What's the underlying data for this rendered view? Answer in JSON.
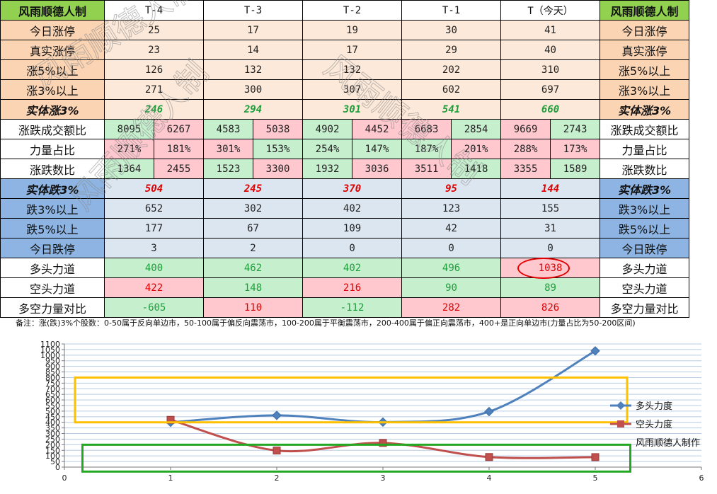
{
  "table": {
    "brand": "风雨顺德人制",
    "columns": [
      "T-4",
      "T-3",
      "T-2",
      "T-1",
      "T（今天）"
    ],
    "rows": [
      {
        "label": "今日涨停",
        "values": [
          "25",
          "17",
          "19",
          "30",
          "41"
        ]
      },
      {
        "label": "真实涨停",
        "values": [
          "23",
          "14",
          "17",
          "29",
          "40"
        ]
      },
      {
        "label": "涨5%以上",
        "values": [
          "126",
          "132",
          "132",
          "202",
          "310"
        ]
      },
      {
        "label": "涨3%以上",
        "values": [
          "271",
          "300",
          "307",
          "602",
          "697"
        ]
      },
      {
        "label": "实体涨3%",
        "values": [
          "246",
          "294",
          "301",
          "541",
          "660"
        ]
      },
      {
        "label": "涨跌成交额比",
        "pairs": [
          [
            "8095",
            "6267"
          ],
          [
            "4583",
            "5038"
          ],
          [
            "4902",
            "4452"
          ],
          [
            "6683",
            "2854"
          ],
          [
            "9669",
            "2743"
          ]
        ]
      },
      {
        "label": "力量占比",
        "pairs": [
          [
            "271%",
            "181%"
          ],
          [
            "301%",
            "153%"
          ],
          [
            "254%",
            "147%"
          ],
          [
            "187%",
            "201%"
          ],
          [
            "288%",
            "173%"
          ]
        ]
      },
      {
        "label": "涨跌数比",
        "pairs": [
          [
            "1364",
            "2455"
          ],
          [
            "1523",
            "3300"
          ],
          [
            "1932",
            "3036"
          ],
          [
            "3511",
            "1418"
          ],
          [
            "3355",
            "1589"
          ]
        ]
      },
      {
        "label": "实体跌3%",
        "values": [
          "504",
          "245",
          "370",
          "95",
          "144"
        ]
      },
      {
        "label": "跌3%以上",
        "values": [
          "652",
          "302",
          "402",
          "123",
          "155"
        ]
      },
      {
        "label": "跌5%以上",
        "values": [
          "177",
          "67",
          "109",
          "42",
          "31"
        ]
      },
      {
        "label": "今日跌停",
        "values": [
          "3",
          "2",
          "0",
          "0",
          "0"
        ]
      },
      {
        "label": "多头力道",
        "values": [
          "400",
          "462",
          "402",
          "496",
          "1038"
        ]
      },
      {
        "label": "空头力道",
        "values": [
          "422",
          "148",
          "216",
          "90",
          "89"
        ]
      },
      {
        "label": "多空力量对比",
        "values": [
          "-605",
          "110",
          "-112",
          "282",
          "826"
        ]
      }
    ],
    "note": "备注：涨(跌)3%个股数：0-50属于反向单边市，50-100属于偏反向震荡市，100-200属于平衡震荡市，200-400属于偏正向震荡市，400+是正向单边市(力量占比为50-200区间)"
  },
  "watermark": "风雨顺德人制",
  "colors": {
    "green_fill": "#c6efce",
    "pink_fill": "#ffc7ce",
    "brand_green": "#92d050",
    "series_bull": "#4f81bd",
    "series_bear": "#c0504d",
    "box_yellow": "#ffc000",
    "box_green": "#22a822",
    "highlight_circle": "#e00000"
  },
  "chart_data": {
    "type": "scatter",
    "x": [
      1,
      2,
      3,
      4,
      5
    ],
    "series": [
      {
        "name": "多头力度",
        "values": [
          400,
          462,
          402,
          496,
          1038
        ],
        "marker": "diamond",
        "color": "#4f81bd"
      },
      {
        "name": "空头力度",
        "values": [
          422,
          148,
          216,
          90,
          89
        ],
        "marker": "square",
        "color": "#c0504d"
      }
    ],
    "legend_extra": "风雨顺德人制作",
    "xlim": [
      0,
      6
    ],
    "ylim": [
      0,
      1100
    ],
    "x_ticks": [
      0,
      1,
      2,
      3,
      4,
      5,
      6
    ],
    "y_ticks": [
      0,
      50,
      100,
      150,
      200,
      250,
      300,
      350,
      400,
      450,
      500,
      550,
      600,
      650,
      700,
      750,
      800,
      850,
      900,
      950,
      1000,
      1050,
      1100
    ],
    "smooth": true,
    "grid": "horizontal",
    "legend": "right",
    "highlight_boxes": [
      {
        "x": [
          0.1,
          5.3
        ],
        "y": [
          400,
          800
        ],
        "color": "#ffc000"
      },
      {
        "x": [
          0.17,
          5.33
        ],
        "y": [
          -40,
          200
        ],
        "color": "#22a822"
      }
    ]
  }
}
